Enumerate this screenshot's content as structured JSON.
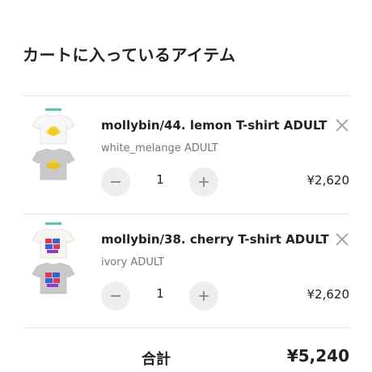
{
  "cart": {
    "title": "カートに入っているアイテム",
    "items": [
      {
        "name": "mollybin/44. lemon T-shirt ADULT",
        "variant": "white_melange ADULT",
        "quantity": "1",
        "price": "¥2,620",
        "thumb_icon": "lemon-tshirt-thumbnail"
      },
      {
        "name": "mollybin/38. cherry T-shirt ADULT",
        "variant": "ivory ADULT",
        "quantity": "1",
        "price": "¥2,620",
        "thumb_icon": "cherry-tshirt-thumbnail"
      }
    ],
    "total_label": "合計",
    "total_value": "¥5,240"
  },
  "icons": {
    "remove": "close-icon",
    "decrease": "minus-icon",
    "increase": "plus-icon"
  },
  "colors": {
    "button_bg": "#eeeeee",
    "divider": "#e5e5e5",
    "muted_text": "#777777"
  }
}
